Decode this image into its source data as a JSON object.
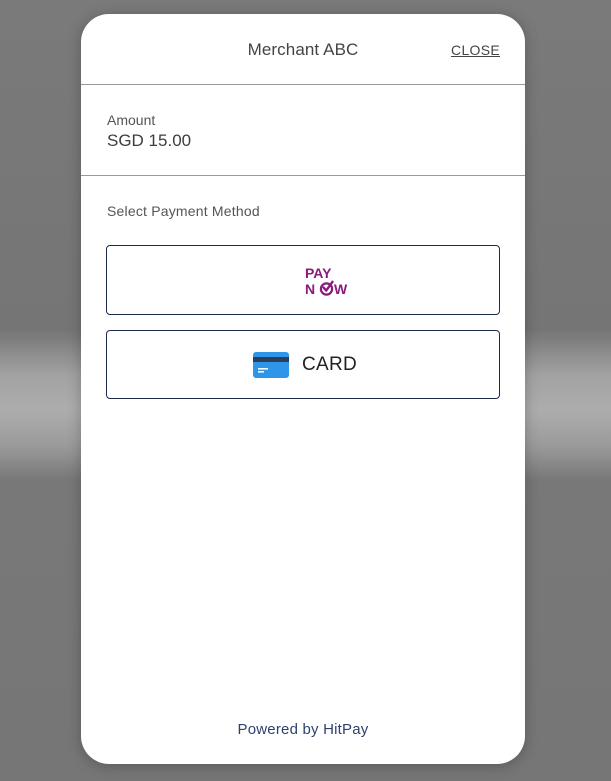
{
  "header": {
    "merchant_name": "Merchant ABC",
    "close_label": "CLOSE"
  },
  "amount": {
    "label": "Amount",
    "value": "SGD 15.00"
  },
  "payment": {
    "section_label": "Select Payment Method",
    "methods": [
      {
        "id": "paynow",
        "logo_top": "PAY",
        "logo_bottom_left": "N",
        "logo_bottom_right": "W",
        "icon": "paynow-logo"
      },
      {
        "id": "card",
        "label": "CARD",
        "icon": "credit-card-icon"
      }
    ]
  },
  "footer": {
    "powered_by": "Powered by HitPay"
  },
  "colors": {
    "button_border": "#1d2b4a",
    "paynow_magenta": "#8b1a7e",
    "card_blue": "#2f95e8",
    "card_stripe": "#2c3e58",
    "footer_text": "#2e4170"
  }
}
